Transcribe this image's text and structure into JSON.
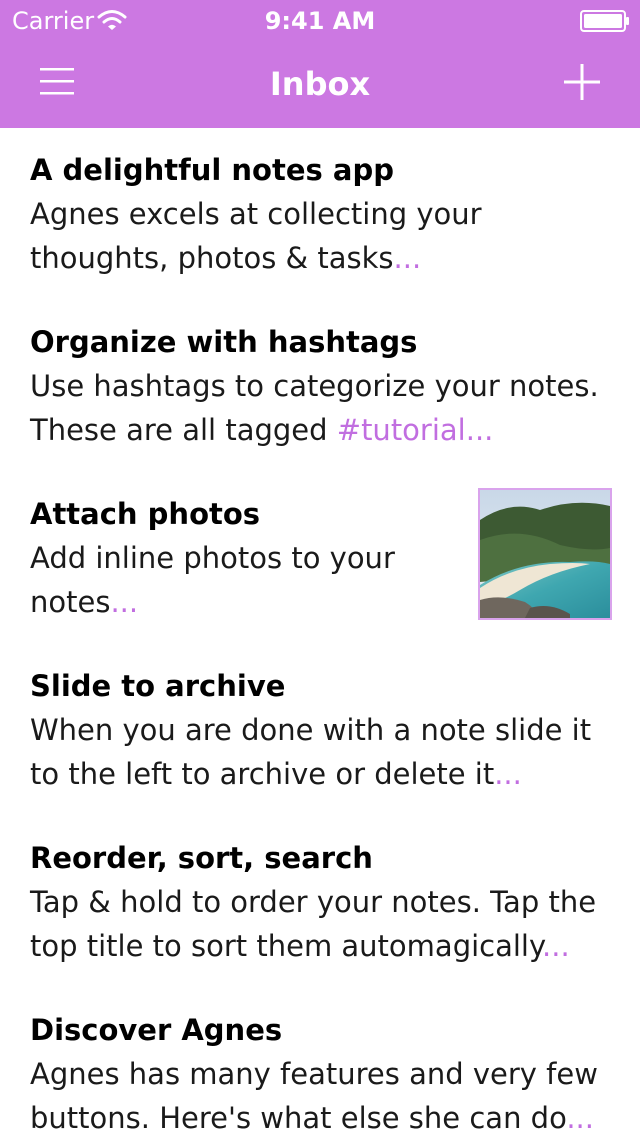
{
  "status_bar": {
    "carrier": "Carrier",
    "time": "9:41 AM"
  },
  "nav": {
    "title": "Inbox",
    "menu_icon": "hamburger-menu-icon",
    "add_icon": "plus-icon"
  },
  "colors": {
    "accent": "#cc78e2",
    "link": "#c16ee0"
  },
  "notes": [
    {
      "title": "A delightful notes app",
      "line1": "Agnes excels at collecting your",
      "line2": "thoughts, photos & tasks",
      "ellipsis": "..."
    },
    {
      "title": "Organize with hashtags",
      "line1": "Use hashtags to categorize your notes.",
      "line2": "These are all tagged ",
      "hashtag": "#tutorial",
      "ellipsis": "..."
    },
    {
      "title": "Attach photos",
      "line1": "Add inline photos to your",
      "line2": "notes",
      "ellipsis": "...",
      "thumbnail": "beach-photo-thumbnail"
    },
    {
      "title": "Slide to archive",
      "line1": "When you are done with a note slide it",
      "line2": "to the left to archive or delete it",
      "ellipsis": "..."
    },
    {
      "title": "Reorder, sort, search",
      "line1": "Tap & hold to order your notes. Tap the",
      "line2": "top title to sort them automagically",
      "ellipsis": "..."
    },
    {
      "title": "Discover Agnes",
      "line1": "Agnes has many features and very few",
      "line2": "buttons. Here's what else she can do",
      "ellipsis": "..."
    }
  ]
}
